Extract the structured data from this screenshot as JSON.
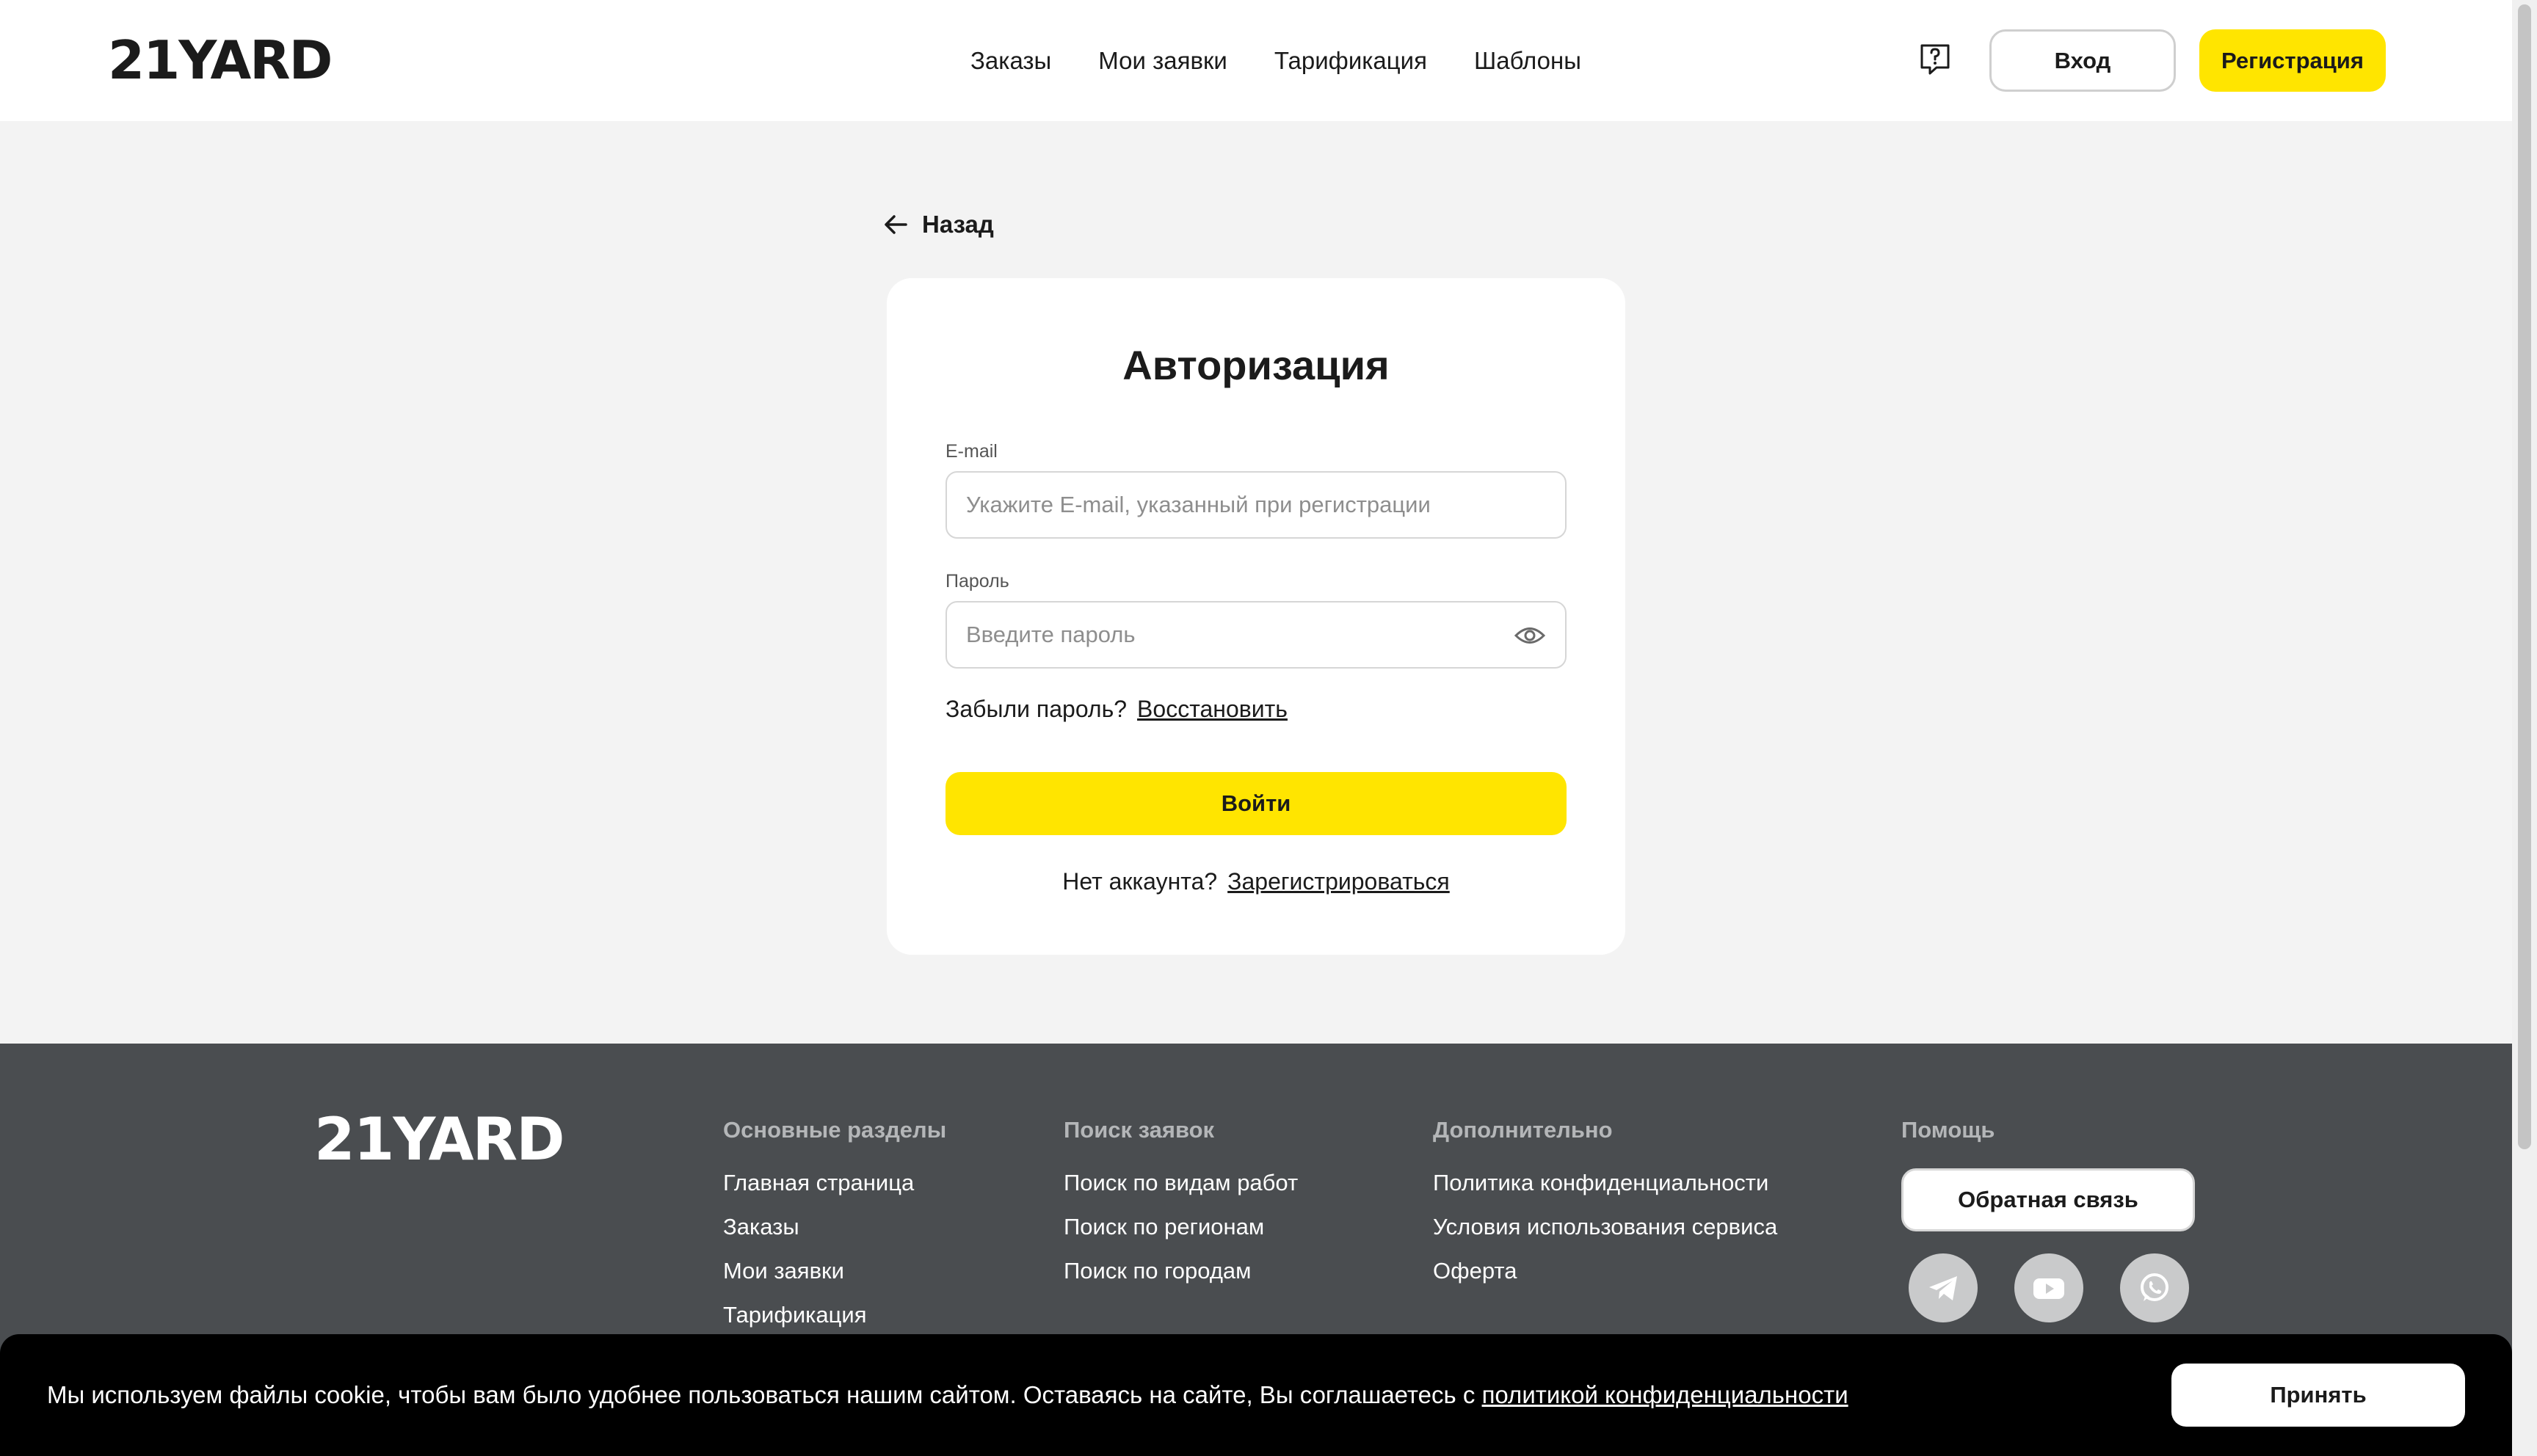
{
  "header": {
    "logo": "21YARD",
    "nav": [
      "Заказы",
      "Мои заявки",
      "Тарификация",
      "Шаблоны"
    ],
    "help_icon": "help-question-icon",
    "login_label": "Вход",
    "register_label": "Регистрация"
  },
  "back": {
    "label": "Назад",
    "icon": "arrow-left-icon"
  },
  "auth": {
    "title": "Авторизация",
    "email_label": "E-mail",
    "email_placeholder": "Укажите E-mail, указанный при регистрации",
    "password_label": "Пароль",
    "password_placeholder": "Введите пароль",
    "eye_icon": "eye-icon",
    "forgot_text": "Забыли пароль?",
    "restore_link": "Восстановить",
    "submit_label": "Войти",
    "no_account_text": "Нет аккаунта?",
    "signup_link": "Зарегистрироваться"
  },
  "footer": {
    "logo": "21YARD",
    "columns": [
      {
        "title": "Основные разделы",
        "links": [
          "Главная страница",
          "Заказы",
          "Мои заявки",
          "Тарификация"
        ]
      },
      {
        "title": "Поиск заявок",
        "links": [
          "Поиск по видам работ",
          "Поиск по регионам",
          "Поиск по городам"
        ]
      },
      {
        "title": "Дополнительно",
        "links": [
          "Политика конфиденциальности",
          "Условия использования сервиса",
          "Оферта"
        ]
      }
    ],
    "help": {
      "title": "Помощь",
      "feedback_label": "Обратная связь",
      "socials": [
        "telegram-icon",
        "youtube-icon",
        "whatsapp-icon"
      ]
    }
  },
  "cookie": {
    "text": "Мы используем файлы cookie, чтобы вам было удобнее пользоваться нашим сайтом. Оставаясь на сайте, Вы соглашаетесь с ",
    "link": "политикой конфиденциальности",
    "accept_label": "Принять"
  },
  "colors": {
    "accent": "#ffe500",
    "footer_bg": "#4a4d50",
    "page_bg": "#f3f3f3"
  }
}
